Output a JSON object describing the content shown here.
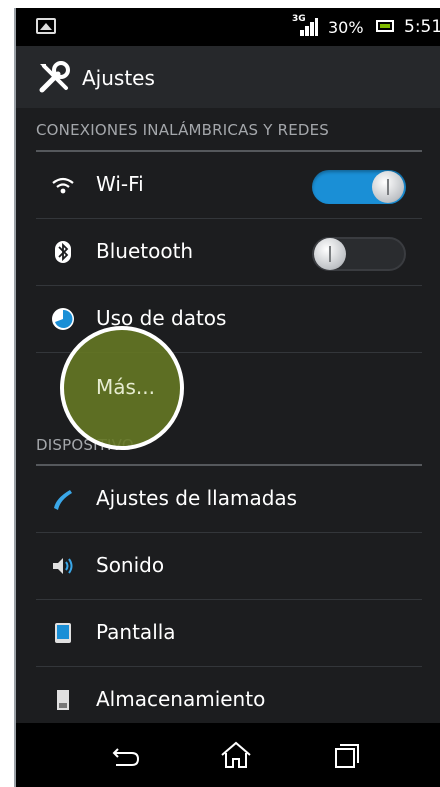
{
  "status_bar": {
    "network": "3G",
    "battery_percent": "30%",
    "time": "5:51"
  },
  "action_bar": {
    "title": "Ajustes",
    "icon": "tools-icon"
  },
  "sections": {
    "wireless": {
      "header": "CONEXIONES INALÁMBRICAS Y REDES",
      "items": [
        {
          "label": "Wi-Fi",
          "icon": "wifi-icon",
          "toggle": "on"
        },
        {
          "label": "Bluetooth",
          "icon": "bluetooth-icon",
          "toggle": "off"
        },
        {
          "label": "Uso de datos",
          "icon": "data-usage-icon"
        },
        {
          "label": "Más..."
        }
      ]
    },
    "device": {
      "header": "DISPOSITIVO",
      "items": [
        {
          "label": "Ajustes de llamadas",
          "icon": "phone-icon"
        },
        {
          "label": "Sonido",
          "icon": "speaker-icon"
        },
        {
          "label": "Pantalla",
          "icon": "display-icon"
        },
        {
          "label": "Almacenamiento",
          "icon": "storage-icon"
        }
      ]
    }
  },
  "nav_bar": {
    "buttons": [
      "back-icon",
      "home-icon",
      "recents-icon"
    ]
  },
  "colors": {
    "accent": "#1a8fd6",
    "touch_indicator": "#657824"
  }
}
